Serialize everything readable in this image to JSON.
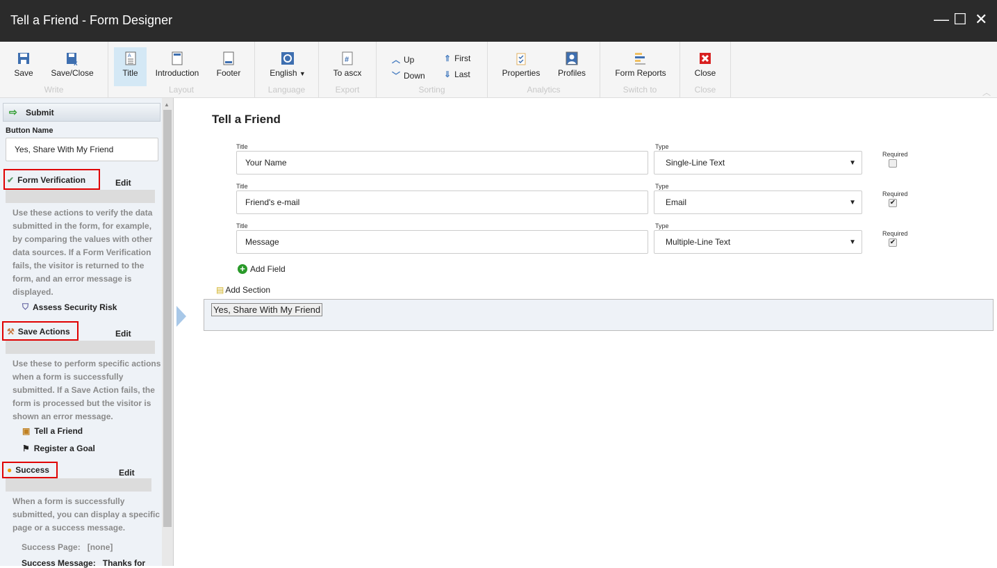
{
  "window": {
    "title": "Tell a Friend - Form Designer",
    "minimize": "—",
    "maximize": "☐",
    "close": "✕"
  },
  "ribbon": {
    "write": {
      "label": "Write",
      "save": "Save",
      "save_close": "Save/Close"
    },
    "layout": {
      "label": "Layout",
      "title": "Title",
      "introduction": "Introduction",
      "footer": "Footer"
    },
    "language": {
      "label": "Language",
      "english": "English"
    },
    "export": {
      "label": "Export",
      "to_ascx": "To ascx"
    },
    "sorting": {
      "label": "Sorting",
      "up": "Up",
      "down": "Down",
      "first": "First",
      "last": "Last"
    },
    "analytics": {
      "label": "Analytics",
      "properties": "Properties",
      "profiles": "Profiles"
    },
    "switch_to": {
      "label": "Switch to",
      "form_reports": "Form Reports"
    },
    "close": {
      "label": "Close",
      "close": "Close"
    }
  },
  "left": {
    "header": "Submit",
    "button_name_label": "Button Name",
    "button_name_value": "Yes, Share With My Friend",
    "edit": "Edit",
    "form_verification": {
      "title": "Form Verification",
      "desc": "Use these actions to verify the data submitted in the form, for example, by comparing the values with other data sources. If a Form Verification fails, the visitor is returned to the form, and an error message is displayed.",
      "items": [
        "Assess Security Risk"
      ]
    },
    "save_actions": {
      "title": "Save Actions",
      "desc": "Use these to perform specific actions when a form is successfully submitted. If a Save Action fails, the form is processed but the visitor is shown an error message.",
      "items": [
        "Tell a Friend",
        "Register a Goal"
      ]
    },
    "success": {
      "title": "Success",
      "desc": "When a form is successfully submitted, you can display a specific page or a success message.",
      "page_label": "Success Page:",
      "page_value": "[none]",
      "message_label": "Success Message:",
      "message_value": "Thanks for"
    }
  },
  "main": {
    "form_title": "Tell a Friend",
    "title_label": "Title",
    "type_label": "Type",
    "required_label": "Required",
    "fields": [
      {
        "title": "Your Name",
        "type": "Single-Line Text",
        "required": false
      },
      {
        "title": "Friend's e-mail",
        "type": "Email",
        "required": true
      },
      {
        "title": "Message",
        "type": "Multiple-Line Text",
        "required": true
      }
    ],
    "add_field": "Add Field",
    "add_section": "Add Section",
    "submit_button": "Yes, Share With My Friend"
  }
}
